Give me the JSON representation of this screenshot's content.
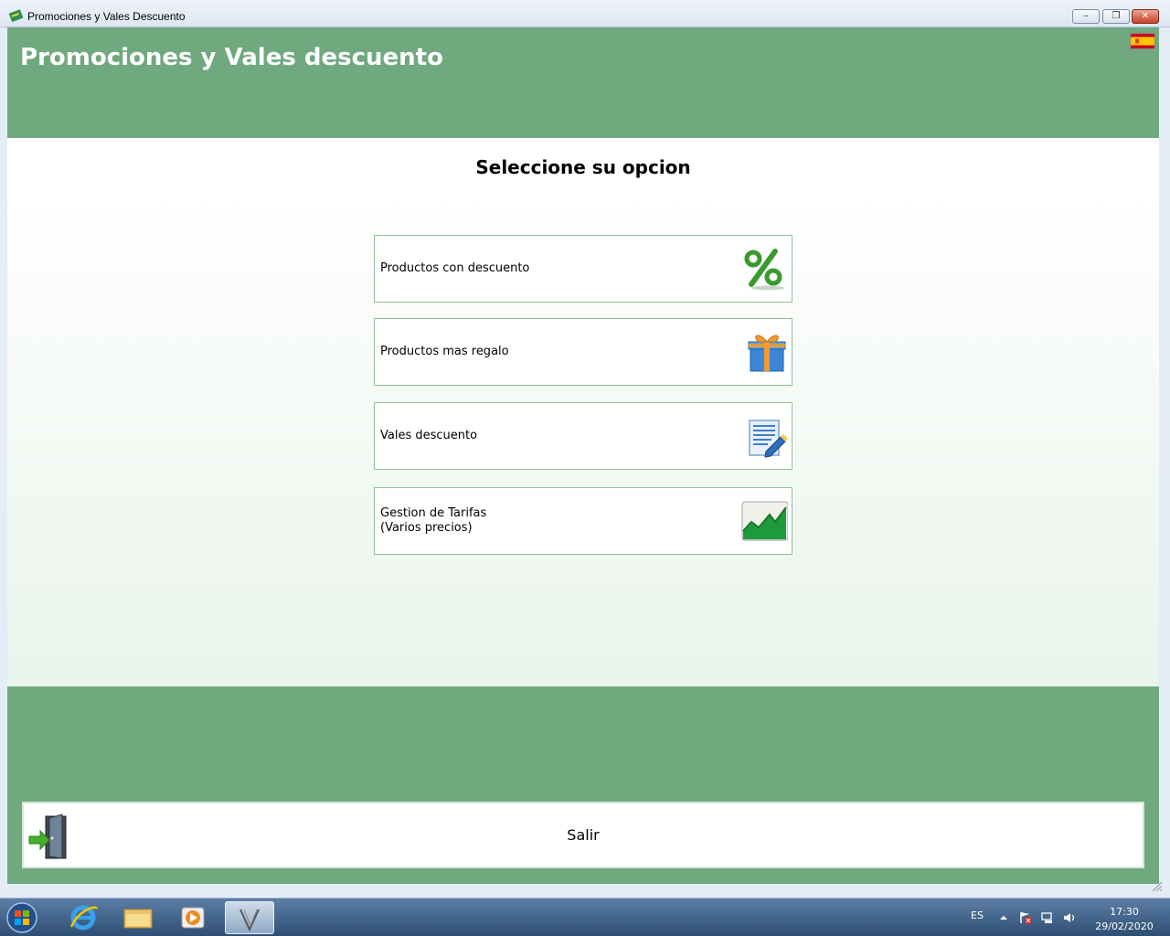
{
  "window": {
    "title": "Promociones y Vales Descuento",
    "buttons": {
      "minimize": "‒",
      "maximize": "❐",
      "close": "✕"
    }
  },
  "header": {
    "title": "Promociones y Vales descuento",
    "language_flag": "flag-es-icon"
  },
  "main": {
    "subtitle": "Seleccione su opcion",
    "options": [
      {
        "label": "Productos con descuento",
        "icon": "percent-icon"
      },
      {
        "label": "Productos mas regalo",
        "icon": "gift-icon"
      },
      {
        "label": "Vales descuento",
        "icon": "document-edit-icon"
      },
      {
        "label": "Gestion de Tarifas\n(Varios precios)",
        "icon": "chart-icon"
      }
    ]
  },
  "footer": {
    "exit_label": "Salir",
    "exit_icon": "exit-door-icon"
  },
  "taskbar": {
    "language": "ES",
    "time": "17:30",
    "date": "29/02/2020"
  },
  "colors": {
    "header_green": "#6fa97d",
    "border_green": "#8fbf9b"
  }
}
